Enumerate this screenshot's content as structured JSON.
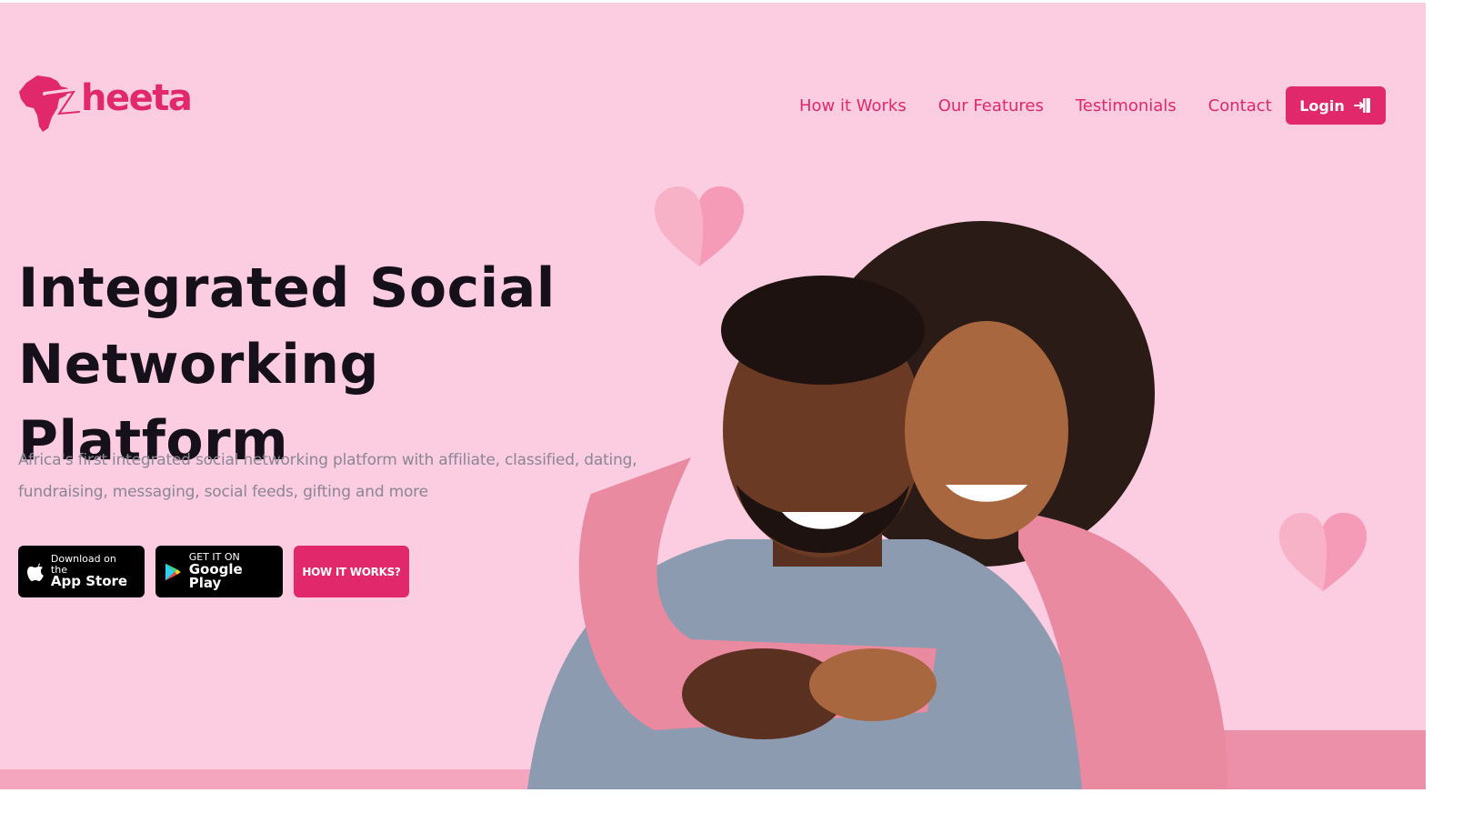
{
  "brand": {
    "name": "Zheeta",
    "logo_text": "heeta",
    "color_primary": "#e0286b",
    "color_background": "#fccde0"
  },
  "nav": {
    "items": [
      {
        "label": "How it Works"
      },
      {
        "label": "Our Features"
      },
      {
        "label": "Testimonials"
      },
      {
        "label": "Contact"
      }
    ],
    "login_label": "Login",
    "login_icon": "login-door-icon"
  },
  "hero": {
    "headline_line1": "Integrated Social",
    "headline_line2": "Networking Platform",
    "subtext_line1": "Africa's first integrated social networking platform with affiliate, classified, dating,",
    "subtext_line2": "fundraising, messaging, social feeds, gifting and more"
  },
  "cta": {
    "app_store_small": "Download on the",
    "app_store_big": "App Store",
    "google_play_small": "GET IT ON",
    "google_play_big": "Google Play",
    "how_it_works": "HOW IT WORKS?"
  },
  "images": {
    "hero_photo": "smiling-couple-embracing-photo",
    "decor": "paper-heart"
  }
}
